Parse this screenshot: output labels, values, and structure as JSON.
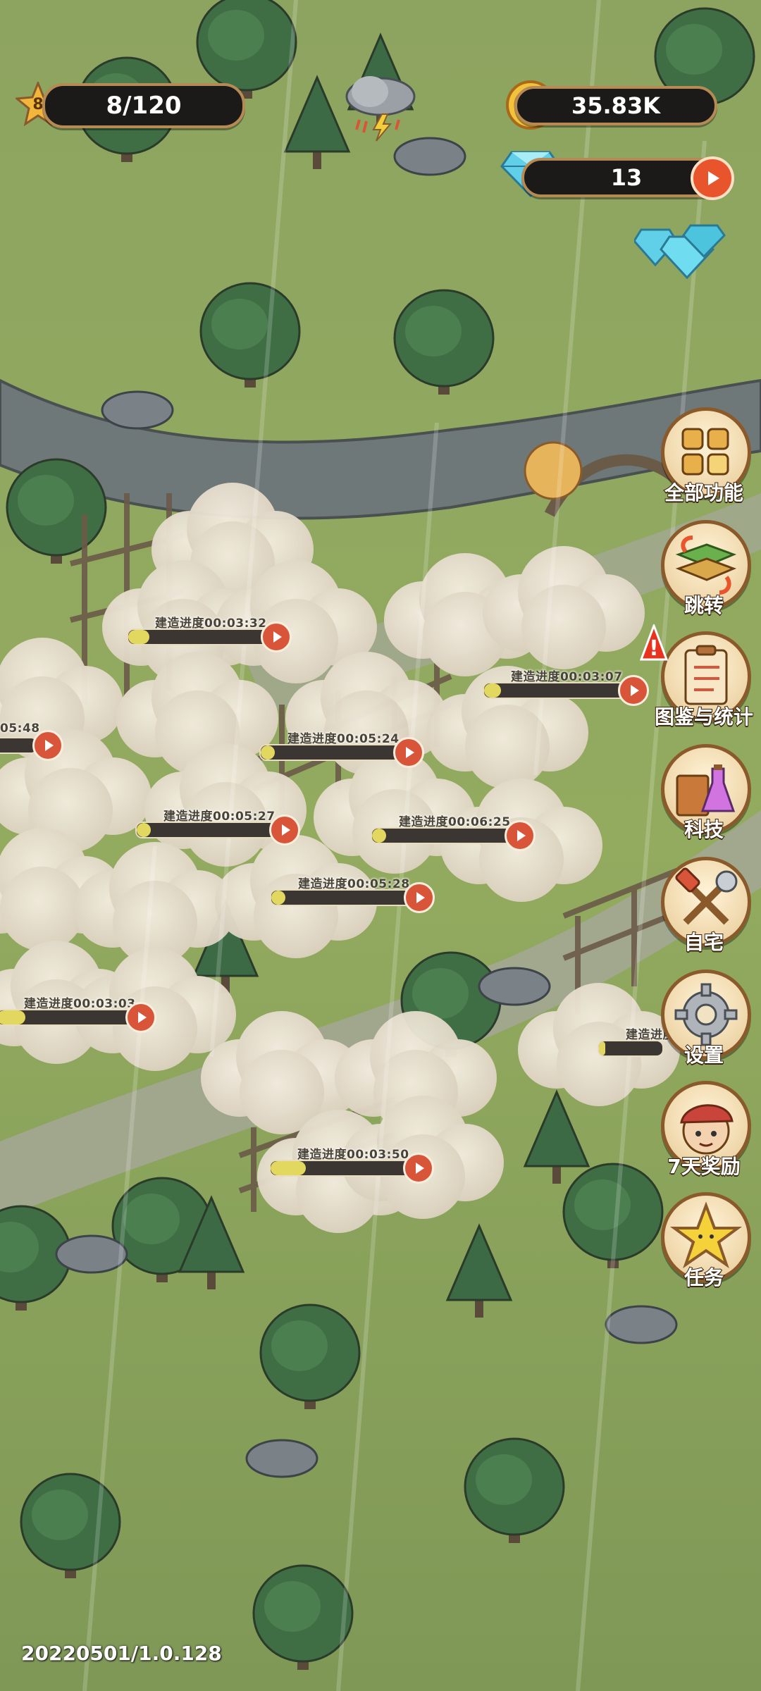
{
  "hud": {
    "level": "8",
    "population": "8/120",
    "gold": "35.83K",
    "gems": "13"
  },
  "weather": "thunderstorm-icon",
  "construction_bars": [
    {
      "label": "建造进度00:03:32",
      "progress": 0.15
    },
    {
      "label": "建造进度00:03:07",
      "progress": 0.12
    },
    {
      "label": "05:48",
      "progress": 0.1
    },
    {
      "label": "建造进度00:05:24",
      "progress": 0.1
    },
    {
      "label": "建造进度00:05:27",
      "progress": 0.1
    },
    {
      "label": "建造进度00:06:25",
      "progress": 0.1
    },
    {
      "label": "建造进度00:05:28",
      "progress": 0.1
    },
    {
      "label": "建造进度00:03:03",
      "progress": 0.2
    },
    {
      "label": "建造进度",
      "progress": 0.1
    },
    {
      "label": "建造进度00:03:50",
      "progress": 0.25
    }
  ],
  "side_menu": [
    {
      "label": "全部功能",
      "icon": "all-functions-icon"
    },
    {
      "label": "跳转",
      "icon": "map-jump-icon"
    },
    {
      "label": "图鉴与统计",
      "icon": "clipboard-stats-icon"
    },
    {
      "label": "科技",
      "icon": "book-potion-icon"
    },
    {
      "label": "自宅",
      "icon": "hammer-wrench-icon"
    },
    {
      "label": "设置",
      "icon": "gear-icon"
    },
    {
      "label": "7天奖励",
      "icon": "character-reward-icon"
    },
    {
      "label": "任务",
      "icon": "star-task-icon"
    }
  ],
  "version": "20220501/1.0.128",
  "colors": {
    "grass": "#8fa85c",
    "road": "#8f9582",
    "river": "#6f7a78",
    "accent_red": "#d9553a",
    "hud_dark": "#1c1a18"
  }
}
